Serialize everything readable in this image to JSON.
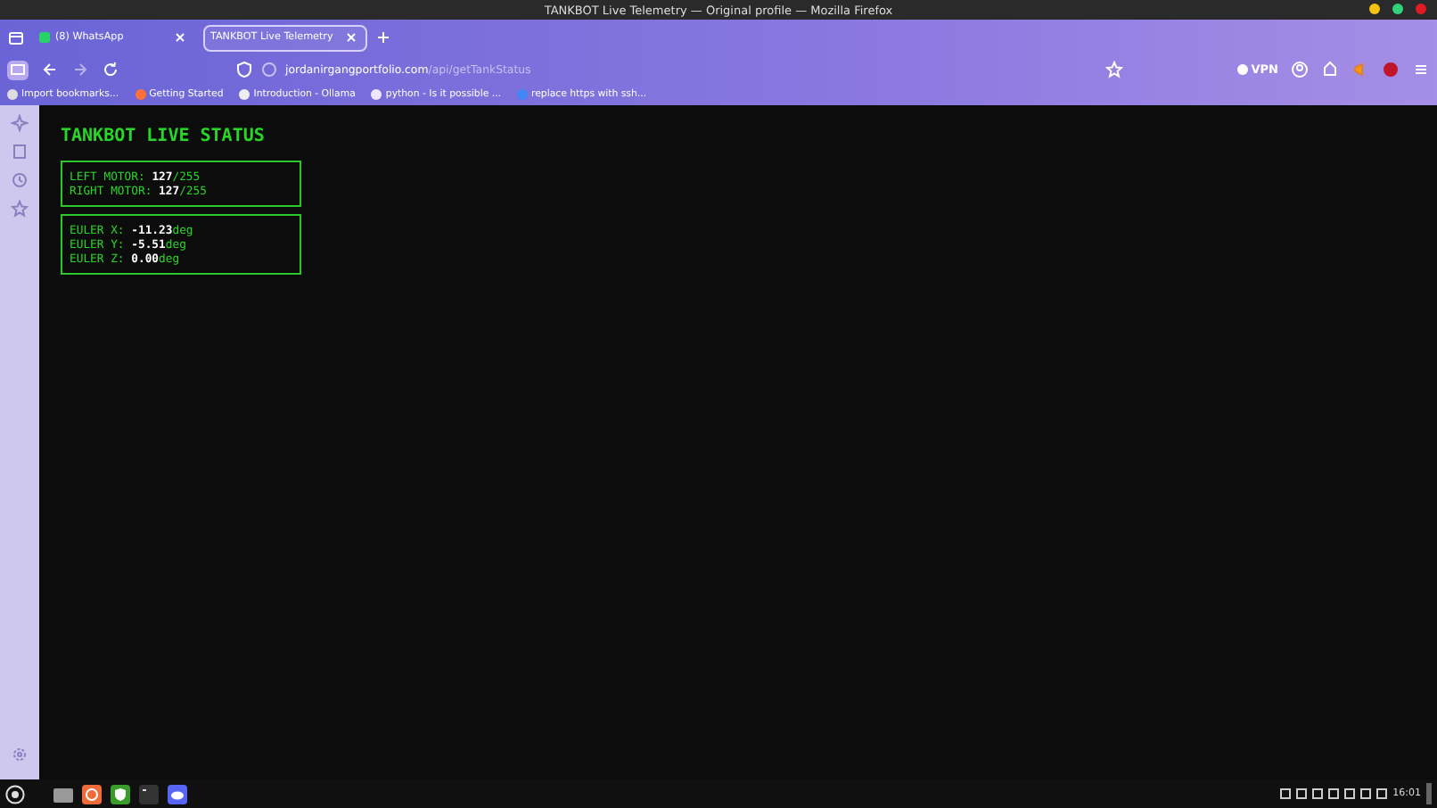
{
  "window": {
    "title": "TANKBOT Live Telemetry — Original profile — Mozilla Firefox"
  },
  "tabs": [
    {
      "label": "(8) WhatsApp",
      "selected": false
    },
    {
      "label": "TANKBOT Live Telemetry",
      "selected": true
    }
  ],
  "address_bar": {
    "host": "jordanirgangportfolio.com",
    "path": "/api/getTankStatus"
  },
  "vpn": "VPN",
  "bookmarks": [
    "Import bookmarks...",
    "Getting Started",
    "Introduction - Ollama",
    "python - Is it possible ...",
    "replace https with ssh..."
  ],
  "page": {
    "title": "TANKBOT LIVE STATUS",
    "panels": [
      {
        "rows": [
          {
            "label": "LEFT MOTOR:",
            "value": "127",
            "unit": "/255"
          },
          {
            "label": "RIGHT MOTOR:",
            "value": "127",
            "unit": "/255"
          }
        ]
      },
      {
        "rows": [
          {
            "label": "EULER X:",
            "value": "-11.23",
            "unit": "deg"
          },
          {
            "label": "EULER Y:",
            "value": "-5.51",
            "unit": "deg"
          },
          {
            "label": "EULER Z:",
            "value": "0.00",
            "unit": "deg"
          }
        ]
      }
    ]
  },
  "taskbar": {
    "clock": "16:01"
  }
}
